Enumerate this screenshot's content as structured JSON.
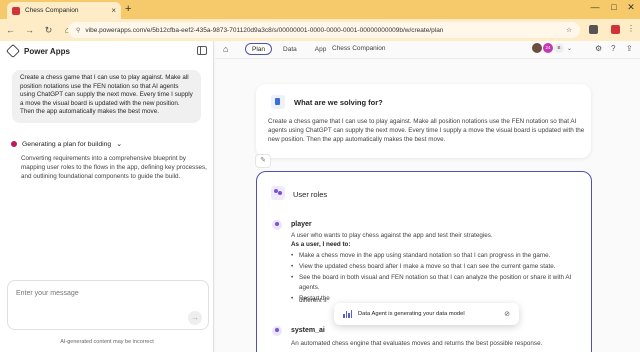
{
  "browser": {
    "tab_title": "Chess Companion",
    "url": "vibe.powerapps.com/e/5b12cfba-eef2-435a-9873-701120d9a3c8/s/00000001-0000-0000-0001-00000000009b/w/create/plan",
    "new_tab": "+",
    "tab_close": "×",
    "win_min": "—",
    "win_max": "□",
    "win_close": "✕",
    "back": "←",
    "forward": "→",
    "reload": "↻",
    "home": "⌂",
    "star": "☆"
  },
  "left": {
    "app_title": "Power Apps",
    "prompt": "Create a chess game that I can use to play against. Make all position notations use the FEN notation so that AI agents using ChatGPT can supply the next move. Every time I supply a move the visual board is updated with the new position. Then the app automatically makes the best move.",
    "status_title": "Generating a plan for building",
    "status_caret": "⌄",
    "status_desc": "Converting requirements into a comprehensive blueprint by mapping user roles to the flows in the app, defining key processes, and outlining foundational components to guide the build.",
    "message_placeholder": "Enter your message",
    "send_glyph": "→",
    "disclaimer": "AI-generated content may be incorrect"
  },
  "nav": {
    "home_glyph": "⌂",
    "tabs": [
      "Plan",
      "Data",
      "App"
    ],
    "app_name": "Chess Companion",
    "avatars": [
      "",
      "24",
      "B"
    ],
    "caret": "⌄",
    "settings_glyph": "⚙",
    "help_glyph": "?",
    "share_glyph": "⇪"
  },
  "problem": {
    "title": "What are we solving for?",
    "text": "Create a chess game that I can use to play against. Make all position notations use the FEN notation so that AI agents using ChatGPT can supply the next move. Every time I supply a move the visual board is updated with the new position. Then the app automatically makes the best move.",
    "edit_glyph": "✎"
  },
  "roles": {
    "title": "User roles",
    "player": {
      "name": "player",
      "desc": "A user who wants to play chess against the app and test their strategies.",
      "need_label": "As a user, I need to:",
      "needs": [
        "Make a chess move in the app using standard notation so that I can progress in the game.",
        "View the updated chess board after I make a move so that I can see the current game state.",
        "See the board in both visual and FEN notation so that I can analyze the position or share it with AI agents.",
        "Restart the"
      ],
      "restart_rest": "different s"
    },
    "system": {
      "name": "system_ai",
      "desc": "An automated chess engine that evaluates moves and returns the best possible response."
    }
  },
  "toast": {
    "text": "Data Agent is generating your data model",
    "eye_glyph": "⊘"
  },
  "colors": {
    "tab_bar": "#f6c96a",
    "toolbar": "#fdecc6",
    "accent": "#4f52b2",
    "role_icon": "#7b52d6"
  }
}
